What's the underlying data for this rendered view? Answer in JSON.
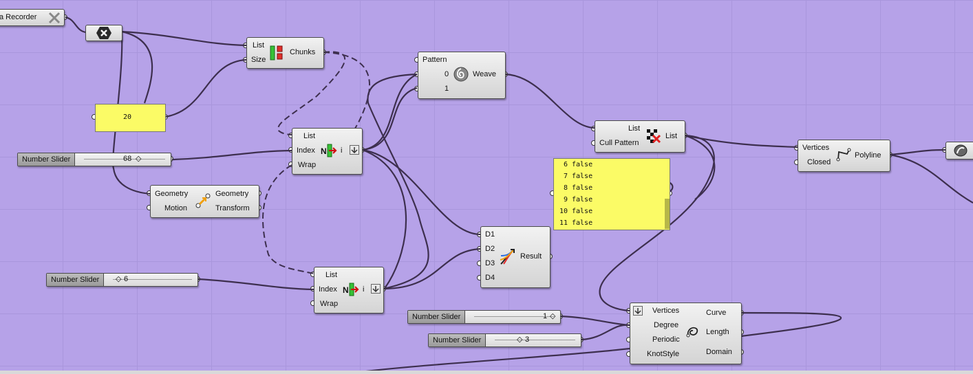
{
  "canvas": {
    "background": "#b6a2e8",
    "panel_color": "#fbfb66",
    "wire_color": "#3d2f4e"
  },
  "recorder": {
    "label": "a Recorder"
  },
  "weave_component": {
    "inputs": [
      "Pattern",
      "0",
      "1"
    ],
    "output": "Weave"
  },
  "chunks_component": {
    "inputs": [
      "List",
      "Size"
    ],
    "output": "Chunks"
  },
  "panel_20": {
    "value": "20"
  },
  "list_item_1": {
    "inputs": [
      "List",
      "Index",
      "Wrap"
    ],
    "output": "i"
  },
  "slider_68": {
    "name": "Number Slider",
    "value": "68"
  },
  "transform_component": {
    "inputs": [
      "Geometry",
      "Motion"
    ],
    "outputs": [
      "Geometry",
      "Transform"
    ]
  },
  "slider_6": {
    "name": "Number Slider",
    "value": "6"
  },
  "list_item_2": {
    "inputs": [
      "List",
      "Index",
      "Wrap"
    ],
    "output": "i"
  },
  "stream_filter": {
    "inputs": [
      "D1",
      "D2",
      "D3",
      "D4"
    ],
    "output": "Result"
  },
  "cull_pattern": {
    "inputs": [
      "List",
      "Cull Pattern"
    ],
    "output": "List"
  },
  "bool_panel": {
    "rows": [
      {
        "i": "6",
        "v": "false"
      },
      {
        "i": "7",
        "v": "false"
      },
      {
        "i": "8",
        "v": "false"
      },
      {
        "i": "9",
        "v": "false"
      },
      {
        "i": "10",
        "v": "false"
      },
      {
        "i": "11",
        "v": "false"
      }
    ]
  },
  "polyline_component": {
    "inputs": [
      "Vertices",
      "Closed"
    ],
    "output": "Polyline"
  },
  "slider_1": {
    "name": "Number Slider",
    "value": "1"
  },
  "slider_3": {
    "name": "Number Slider",
    "value": "3"
  },
  "nurbs_curve": {
    "inputs": [
      "Vertices",
      "Degree",
      "Periodic",
      "KnotStyle"
    ],
    "outputs": [
      "Curve",
      "Length",
      "Domain"
    ]
  }
}
